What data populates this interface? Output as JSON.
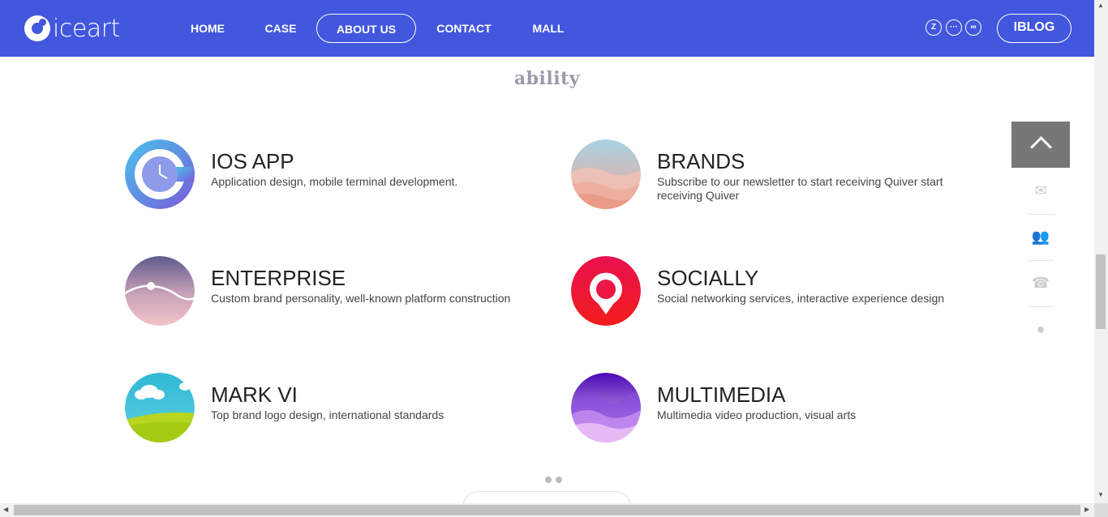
{
  "header": {
    "logo_text": "iceart",
    "nav": [
      {
        "label": "HOME",
        "active": false
      },
      {
        "label": "CASE",
        "active": false
      },
      {
        "label": "ABOUT US",
        "active": true
      },
      {
        "label": "CONTACT",
        "active": false
      },
      {
        "label": "MALL",
        "active": false
      }
    ],
    "social_icons": [
      "zhihu-icon",
      "wechat-icon",
      "weibo-icon"
    ],
    "social_glyphs": [
      "Z",
      "···",
      "∞"
    ],
    "blog_label": "IBLOG"
  },
  "section": {
    "title": "ability",
    "services": [
      {
        "icon": "ios-app-icon",
        "title": "IOS APP",
        "desc": "Application design, mobile terminal development."
      },
      {
        "icon": "brands-icon",
        "title": "BRANDS",
        "desc": "Subscribe to our newsletter to start receiving Quiver start receiving Quiver"
      },
      {
        "icon": "enterprise-icon",
        "title": "ENTERPRISE",
        "desc": "Custom brand personality, well-known platform construction"
      },
      {
        "icon": "socially-icon",
        "title": "SOCIALLY",
        "desc": "Social networking services, interactive experience design"
      },
      {
        "icon": "mark-vi-icon",
        "title": "MARK VI",
        "desc": "Top brand logo design, international standards"
      },
      {
        "icon": "multimedia-icon",
        "title": "MULTIMEDIA",
        "desc": "Multimedia video production, visual arts"
      }
    ]
  },
  "float_panel": {
    "items": [
      "mail-icon",
      "user-icon",
      "phone-icon",
      "qq-icon"
    ],
    "glyphs": [
      "✉",
      "👥",
      "☎",
      "●"
    ]
  },
  "colors": {
    "header_bg": "#4257dd",
    "float_top_bg": "#777777"
  }
}
